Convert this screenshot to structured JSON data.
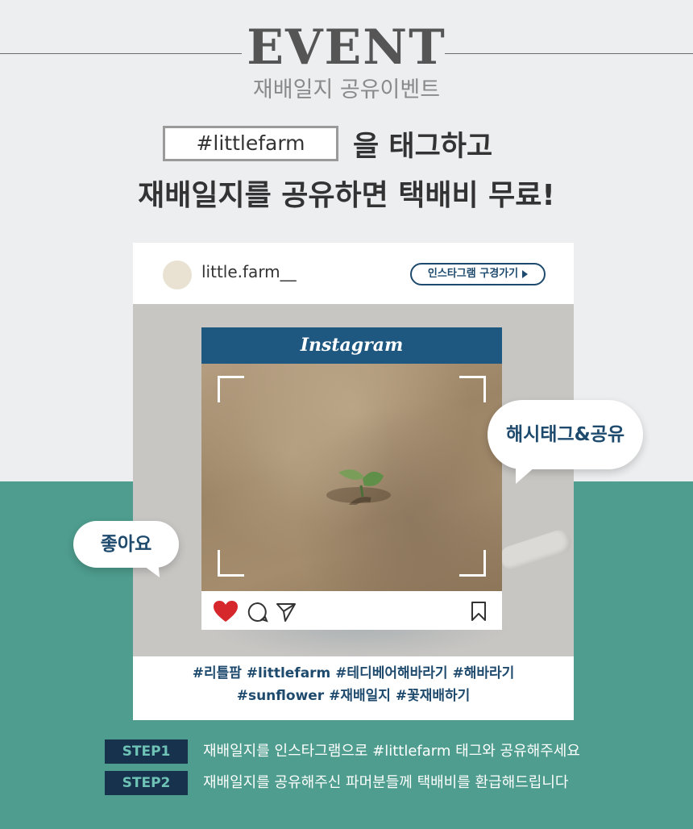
{
  "header": {
    "event_title": "EVENT",
    "event_subtitle": "재배일지 공유이벤트",
    "tag": "#littlefarm",
    "headline_line1_rest": "을 태그하고",
    "headline_line2": "재배일지를 공유하면 택배비 무료!"
  },
  "card": {
    "username": "little.farm__",
    "instagram_button": "인스타그램 구경가기",
    "ig_logo_text": "Instagram",
    "hashtags_line1": "#리틀팜 #littlefarm #테디베어해바라기 #해바라기",
    "hashtags_line2": "#sunflower #재배일지 #꽃재배하기"
  },
  "bubbles": {
    "share": "해시태그&공유",
    "like": "좋아요"
  },
  "steps": [
    {
      "label": "STEP1",
      "text": "재배일지를 인스타그램으로 #littlefarm 태그와 공유해주세요"
    },
    {
      "label": "STEP2",
      "text": "재배일지를 공유해주신 파머분들께 택배비를 환급해드립니다"
    }
  ],
  "icons": [
    "heart-icon",
    "comment-icon",
    "send-icon",
    "bookmark-icon",
    "play-triangle-icon"
  ],
  "colors": {
    "navy": "#1e4a6e",
    "teal": "#4e9d8e",
    "heart": "#d6282c"
  }
}
